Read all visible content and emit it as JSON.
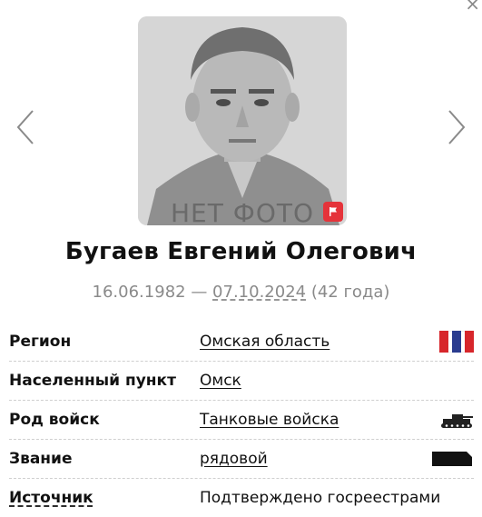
{
  "photo": {
    "placeholder_text": "НЕТ ФОТО",
    "flag_icon": "flag-icon"
  },
  "navigation": {
    "prev_icon": "chevron-left-icon",
    "next_icon": "chevron-right-icon",
    "close_label": "×"
  },
  "person": {
    "name": "Бугаев Евгений Олегович",
    "birth_date": "16.06.1982",
    "separator": " — ",
    "death_date": "07.10.2024",
    "age": " (42 года)"
  },
  "details": [
    {
      "label": "Регион",
      "value": "Омская область",
      "icon": "region-flag-icon"
    },
    {
      "label": "Населенный пункт",
      "value": "Омск",
      "icon": ""
    },
    {
      "label": "Род войск",
      "value": "Танковые войска",
      "icon": "tank-icon"
    },
    {
      "label": "Звание",
      "value": "рядовой",
      "icon": "rank-shoulder-board-icon"
    },
    {
      "label": "Источник",
      "value": "Подтверждено госреестрами",
      "icon": ""
    }
  ],
  "colors": {
    "flag_button": "#e5333a",
    "region_flag_red": "#d7262b",
    "region_flag_blue": "#2a3c8f"
  }
}
